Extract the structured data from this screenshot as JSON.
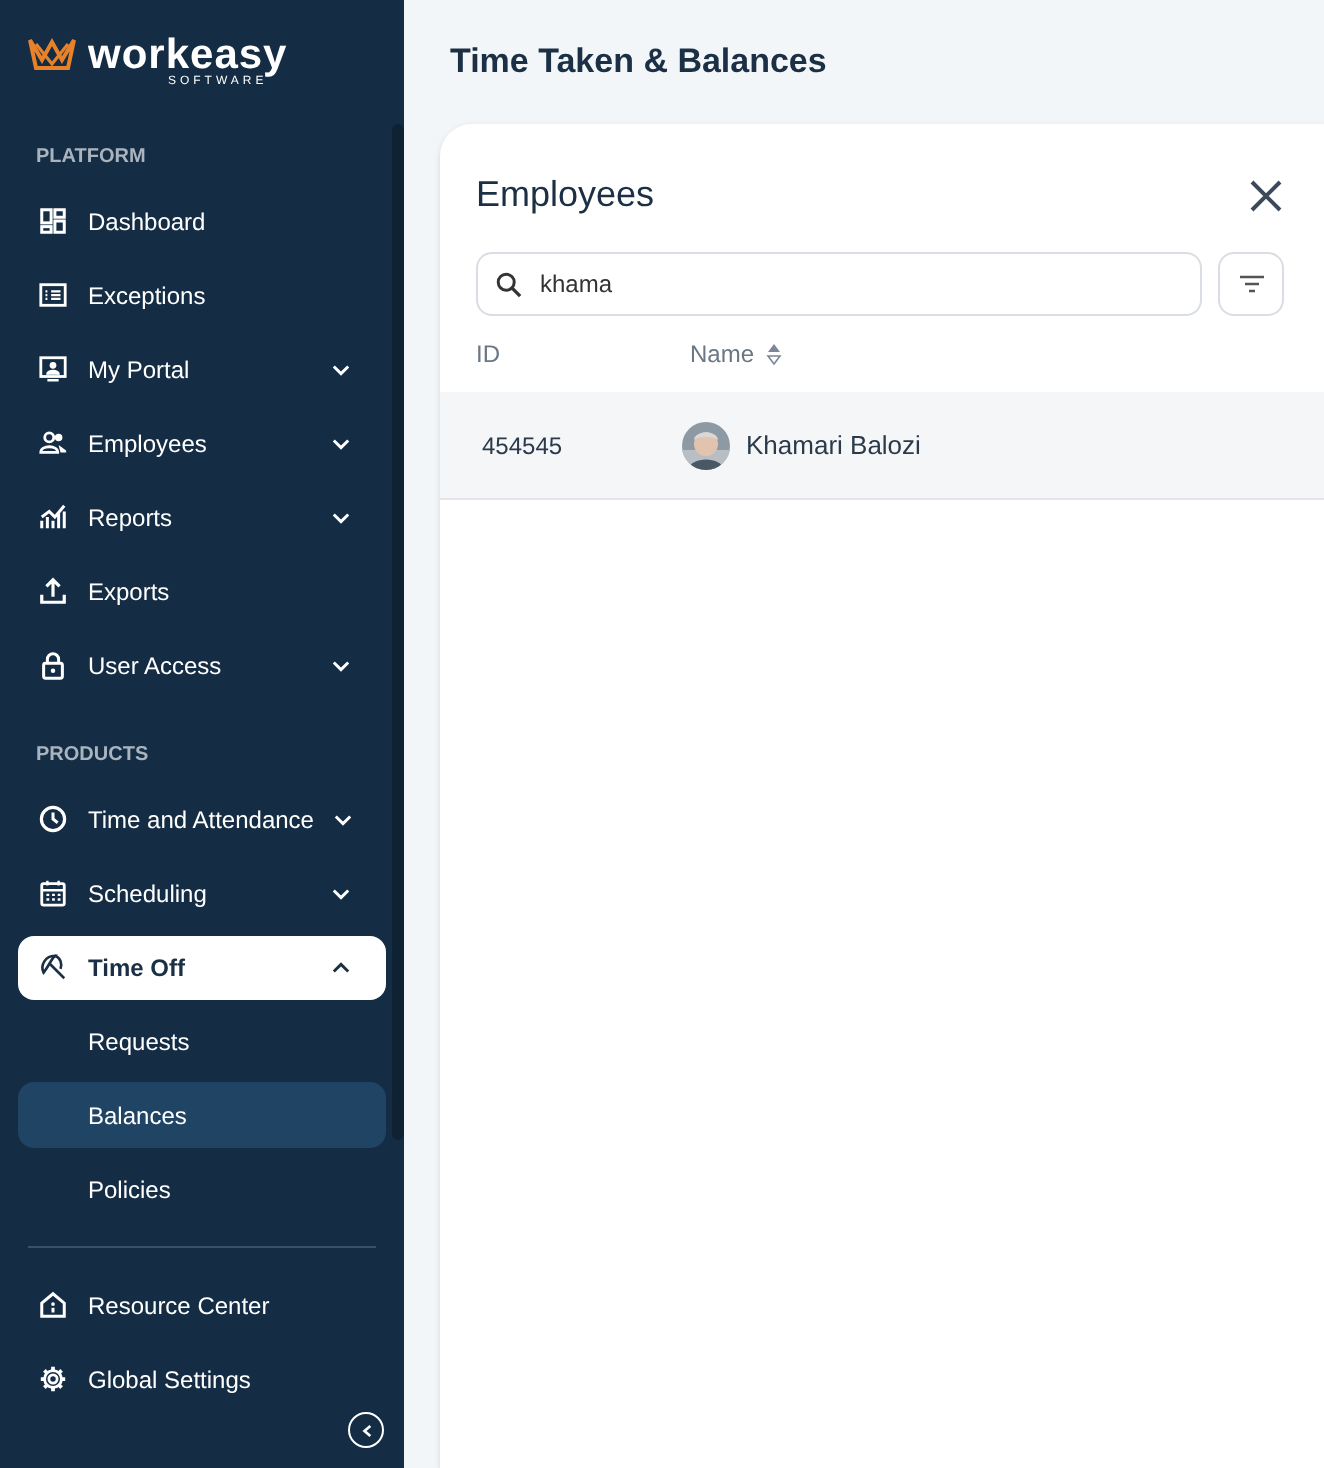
{
  "logo": {
    "name": "workeasy",
    "tagline": "SOFTWARE"
  },
  "sidebar": {
    "sections": [
      {
        "heading": "PLATFORM",
        "items": [
          {
            "label": "Dashboard",
            "kind": "plain",
            "selected": false
          },
          {
            "label": "Exceptions",
            "kind": "plain",
            "selected": false
          },
          {
            "label": "My Portal",
            "kind": "expandable",
            "expanded": false,
            "selected": false
          },
          {
            "label": "Employees",
            "kind": "expandable",
            "expanded": false,
            "selected": false
          },
          {
            "label": "Reports",
            "kind": "expandable",
            "expanded": false,
            "selected": false
          },
          {
            "label": "Exports",
            "kind": "plain",
            "selected": false
          },
          {
            "label": "User Access",
            "kind": "expandable",
            "expanded": false,
            "selected": false
          }
        ]
      },
      {
        "heading": "PRODUCTS",
        "items": [
          {
            "label": "Time and Attendance",
            "kind": "expandable",
            "expanded": false,
            "selected": false
          },
          {
            "label": "Scheduling",
            "kind": "expandable",
            "expanded": false,
            "selected": false
          },
          {
            "label": "Time Off",
            "kind": "expandable",
            "expanded": true,
            "selected": true,
            "children": [
              {
                "label": "Requests",
                "selected": false
              },
              {
                "label": "Balances",
                "selected": true
              },
              {
                "label": "Policies",
                "selected": false
              }
            ]
          }
        ]
      }
    ],
    "footer_items": [
      {
        "label": "Resource Center"
      },
      {
        "label": "Global Settings"
      }
    ]
  },
  "page_title": "Time Taken & Balances",
  "panel": {
    "title": "Employees",
    "search": {
      "value": "khama"
    },
    "columns": [
      {
        "label": "ID",
        "kind": "plain"
      },
      {
        "label": "Name",
        "kind": "sortable"
      }
    ],
    "rows": [
      {
        "id": "454545",
        "name": "Khamari Balozi"
      }
    ]
  }
}
